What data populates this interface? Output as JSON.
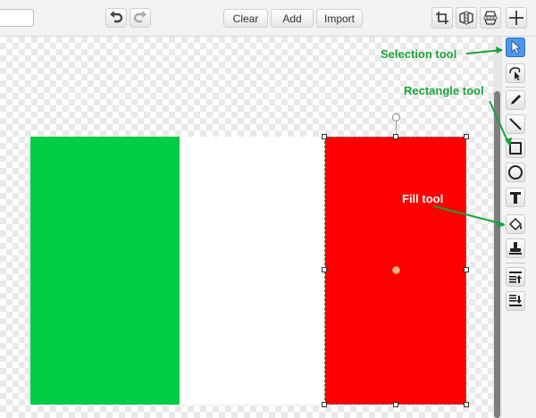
{
  "toolbar": {
    "name_value": "",
    "undo_icon": "undo-icon",
    "redo_icon": "redo-icon",
    "clear_label": "Clear",
    "add_label": "Add",
    "import_label": "Import",
    "crop_icon": "crop-icon",
    "flip_horizontal_icon": "flip-horizontal-icon",
    "flip_vertical_icon": "flip-vertical-icon",
    "set_center_icon": "crosshair-icon"
  },
  "canvas": {
    "flag_colors": {
      "green": "#00cc44",
      "white": "#ffffff",
      "red": "#ff0000"
    }
  },
  "tools": [
    {
      "icon": "select-arrow-icon",
      "active": true
    },
    {
      "icon": "reshape-icon",
      "active": false
    },
    {
      "icon": "pencil-icon",
      "active": false
    },
    {
      "icon": "line-icon",
      "active": false
    },
    {
      "icon": "rectangle-icon",
      "active": false
    },
    {
      "icon": "ellipse-icon",
      "active": false
    },
    {
      "icon": "text-icon",
      "active": false
    },
    {
      "icon": "paint-bucket-icon",
      "active": false
    },
    {
      "icon": "stamp-icon",
      "active": false
    },
    {
      "icon": "bring-forward-icon",
      "active": false
    },
    {
      "icon": "send-backward-icon",
      "active": false
    }
  ],
  "annotations": {
    "selection": "Selection tool",
    "rectangle": "Rectangle tool",
    "fill": "Fill tool"
  },
  "colors": {
    "accent": "#4d97ea",
    "annotation_green": "#1aa33a"
  }
}
